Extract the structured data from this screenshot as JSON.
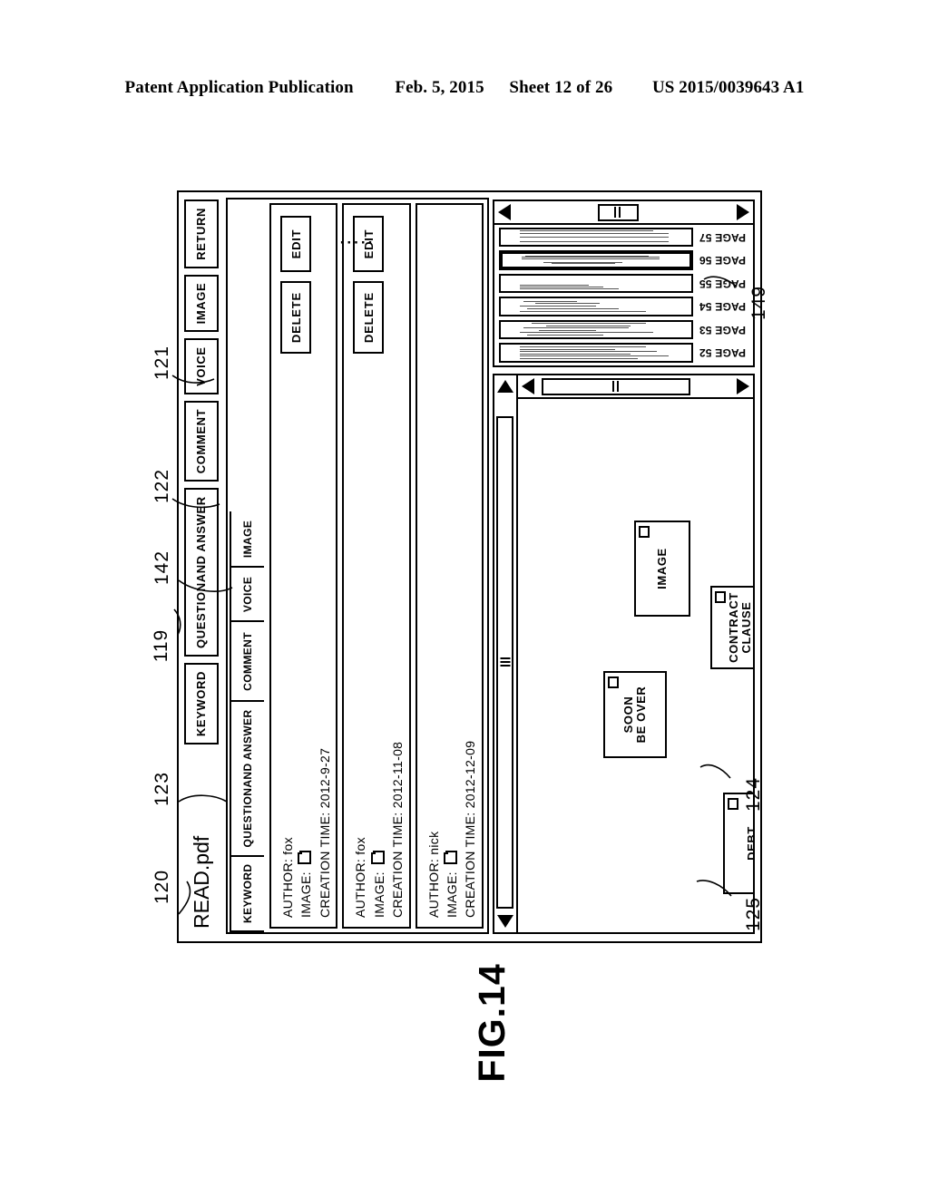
{
  "patent_header": {
    "publication": "Patent Application Publication",
    "date": "Feb. 5, 2015",
    "sheet": "Sheet 12 of 26",
    "number": "US 2015/0039643 A1"
  },
  "figure": {
    "label": "FIG.14"
  },
  "window": {
    "document_title": "READ.pdf",
    "toolbar": [
      {
        "label": "KEYWORD"
      },
      {
        "label": "QUESTION\nAND ANSWER"
      },
      {
        "label": "COMMENT"
      },
      {
        "label": "VOICE"
      },
      {
        "label": "IMAGE"
      },
      {
        "label": "RETURN"
      }
    ],
    "toolbar_labels": {
      "keyword": "KEYWORD",
      "qa_line1": "QUESTION",
      "qa_line2": "AND ANSWER",
      "comment": "COMMENT",
      "voice": "VOICE",
      "image": "IMAGE",
      "return": "RETURN"
    }
  },
  "annotation_panel": {
    "tabs": {
      "keyword": "KEYWORD",
      "qa_line1": "QUESTION",
      "qa_line2": "AND ANSWER",
      "comment": "COMMENT",
      "voice": "VOICE",
      "image": "IMAGE"
    },
    "active_tab": "QUESTION AND ANSWER",
    "field_labels": {
      "author": "AUTHOR:",
      "image": "IMAGE:",
      "creation_time": "CREATION TIME:"
    },
    "buttons": {
      "delete": "DELETE",
      "edit": "EDIT"
    },
    "more_indicator": ".....",
    "cards": [
      {
        "author_label": "AUTHOR:",
        "author": "fox",
        "image_label": "IMAGE:",
        "time_label": "CREATION TIME:",
        "time": "2012-9-27",
        "delete": "DELETE",
        "edit": "EDIT",
        "has_actions": true
      },
      {
        "author_label": "AUTHOR:",
        "author": "fox",
        "image_label": "IMAGE:",
        "time_label": "CREATION TIME:",
        "time": "2012-11-08",
        "delete": "DELETE",
        "edit": "EDIT",
        "has_actions": true
      },
      {
        "author_label": "AUTHOR:",
        "author": "nick",
        "image_label": "IMAGE:",
        "time_label": "CREATION TIME:",
        "time": "2012-12-09",
        "has_actions": false
      }
    ]
  },
  "viewer": {
    "annotations": [
      {
        "text": "DEBT",
        "line1": "DEBT",
        "line2": ""
      },
      {
        "text": "SOON BE OVER",
        "line1": "SOON",
        "line2": "BE OVER"
      },
      {
        "text": "CONTRACT CLAUSE",
        "line1": "CONTRACT",
        "line2": "CLAUSE"
      },
      {
        "text": "IMAGE",
        "line1": "IMAGE",
        "line2": ""
      }
    ],
    "anno_labels": {
      "debt": "DEBT",
      "soon": "SOON",
      "be_over": "BE OVER",
      "contract": "CONTRACT",
      "clause": "CLAUSE",
      "image": "IMAGE"
    }
  },
  "thumbnails": {
    "pages": [
      {
        "label": "PAGE 52",
        "selected": false
      },
      {
        "label": "PAGE 53",
        "selected": false
      },
      {
        "label": "PAGE 54",
        "selected": false
      },
      {
        "label": "PAGE 55",
        "selected": false
      },
      {
        "label": "PAGE 56",
        "selected": true
      },
      {
        "label": "PAGE 57",
        "selected": false
      }
    ],
    "labels": {
      "p52": "PAGE 52",
      "p53": "PAGE 53",
      "p54": "PAGE 54",
      "p55": "PAGE 55",
      "p56": "PAGE 56",
      "p57": "PAGE 57"
    }
  },
  "reference_numerals": {
    "r119": "119",
    "r120": "120",
    "r121": "121",
    "r122": "122",
    "r123": "123",
    "r124": "124",
    "r125": "125",
    "r142": "142",
    "r149": "149"
  }
}
